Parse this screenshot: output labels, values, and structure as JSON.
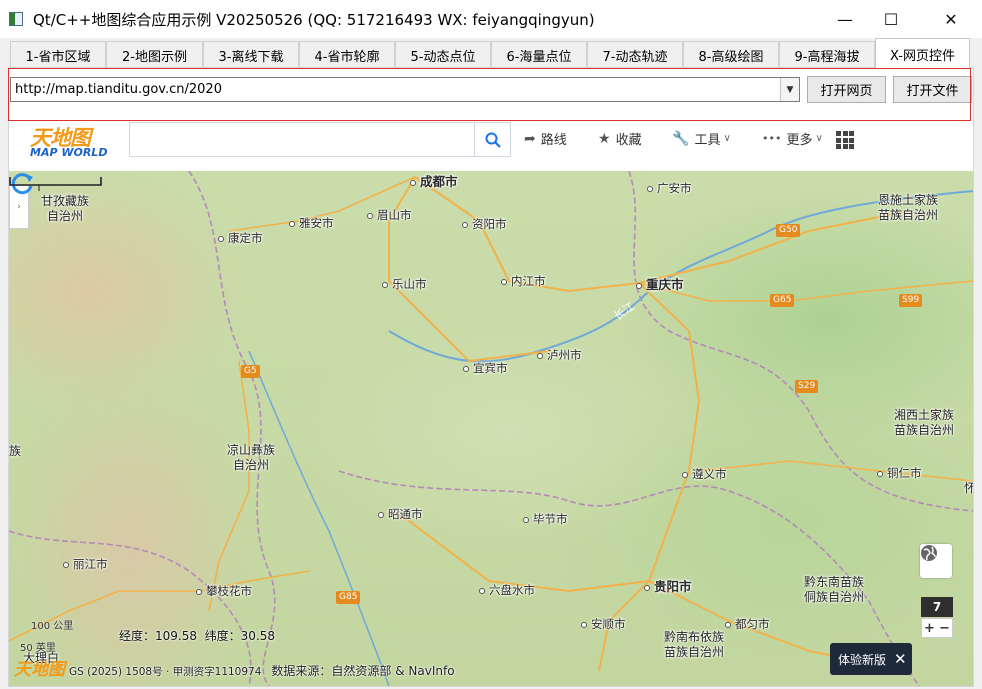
{
  "window": {
    "title": "Qt/C++地图综合应用示例 V20250526 (QQ: 517216493 WX: feiyangqingyun)",
    "min_glyph": "—",
    "max_glyph": "☐",
    "close_glyph": "✕"
  },
  "tabs": [
    {
      "label": "1-省市区域",
      "active": false
    },
    {
      "label": "2-地图示例",
      "active": false
    },
    {
      "label": "3-离线下载",
      "active": false
    },
    {
      "label": "4-省市轮廓",
      "active": false
    },
    {
      "label": "5-动态点位",
      "active": false
    },
    {
      "label": "6-海量点位",
      "active": false
    },
    {
      "label": "7-动态轨迹",
      "active": false
    },
    {
      "label": "8-高级绘图",
      "active": false
    },
    {
      "label": "9-高程海拔",
      "active": false
    },
    {
      "label": "X-网页控件",
      "active": true
    }
  ],
  "toolbar": {
    "url_value": "http://map.tianditu.gov.cn/2020",
    "open_web_label": "打开网页",
    "open_file_label": "打开文件"
  },
  "web": {
    "logo_cn": "天地图",
    "logo_en": "MAP WORLD",
    "search_placeholder": "",
    "route_label": "路线",
    "favorites_label": "收藏",
    "tools_label": "工具",
    "more_label": "更多"
  },
  "map": {
    "cities": [
      {
        "name": "成都市",
        "big": true
      },
      {
        "name": "广安市",
        "big": false
      },
      {
        "name": "雅安市",
        "big": false
      },
      {
        "name": "眉山市",
        "big": false
      },
      {
        "name": "资阳市",
        "big": false
      },
      {
        "name": "康定市",
        "big": false
      },
      {
        "name": "乐山市",
        "big": false
      },
      {
        "name": "内江市",
        "big": false
      },
      {
        "name": "重庆市",
        "big": true
      },
      {
        "name": "宜宾市",
        "big": false
      },
      {
        "name": "泸州市",
        "big": false
      },
      {
        "name": "遵义市",
        "big": false
      },
      {
        "name": "铜仁市",
        "big": false
      },
      {
        "name": "昭通市",
        "big": false
      },
      {
        "name": "毕节市",
        "big": false
      },
      {
        "name": "丽江市",
        "big": false
      },
      {
        "name": "攀枝花市",
        "big": false
      },
      {
        "name": "六盘水市",
        "big": false
      },
      {
        "name": "贵阳市",
        "big": true
      },
      {
        "name": "安顺市",
        "big": false
      },
      {
        "name": "都匀市",
        "big": false
      }
    ],
    "regions": [
      {
        "line1": "甘孜藏族",
        "line2": "自治州"
      },
      {
        "line1": "恩施土家族",
        "line2": "苗族自治州"
      },
      {
        "line1": "凉山彝族",
        "line2": "自治州"
      },
      {
        "line1": "湘西土家族",
        "line2": "苗族自治州"
      },
      {
        "line1": "黔东南苗族",
        "line2": "侗族自治州"
      },
      {
        "line1": "黔南布依族",
        "line2": "苗族自治州"
      },
      {
        "line1": "大理白",
        "line2": ""
      }
    ],
    "edge_labels": [
      "族",
      "怀"
    ],
    "highways": [
      "G50",
      "G65",
      "S99",
      "G5",
      "S29",
      "G85"
    ],
    "river_label": "长江",
    "zoom_level": "7",
    "zoom_in": "+",
    "zoom_out": "−",
    "new_version_label": "体验新版",
    "scale_top": "100 公里",
    "scale_bottom": "50 英里",
    "lng_label": "经度：",
    "lng_value": "109.58",
    "lat_label": "纬度：",
    "lat_value": "30.58",
    "copyright_gs": "GS (2025) 1508",
    "copyright_mid": "号 · 甲测资字1110974",
    "data_source": "数据来源：自然资源部 & NavInfo",
    "mini_logo": "天地图"
  },
  "colors": {
    "accent_red": "#e0302c",
    "logo_orange": "#f39a18",
    "logo_blue": "#1b63c6",
    "highway": "#e48a1e",
    "road": "#f2b24a",
    "boundary": "#b58ab8",
    "river": "#6fa9d8"
  }
}
